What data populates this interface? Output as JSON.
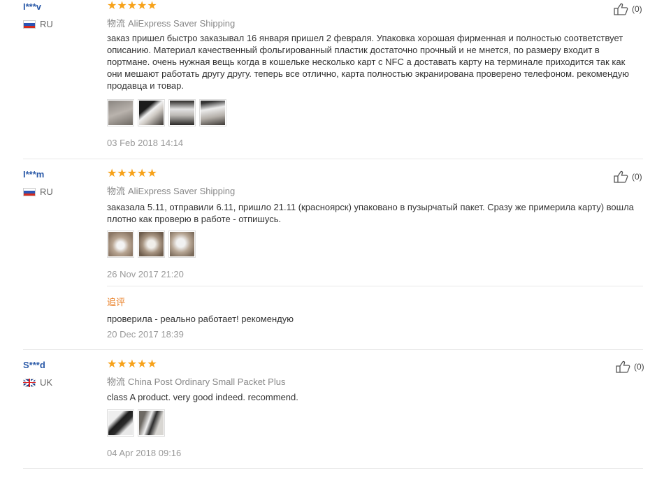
{
  "reviews": [
    {
      "user": "I***v",
      "country": "RU",
      "shipping_label": "物流",
      "shipping": "AliExpress Saver Shipping",
      "text": "заказ пришел быстро заказывал 16 января пришел 2 февраля. Упаковка хорошая фирменная и полностью соответствует описанию. Материал качественный фольгированный пластик достаточно прочный и не мнется, по размеру входит в портмане. очень нужная вещь когда в кошельке несколько карт с NFC а доставать карту на терминале приходится так как они мешают работать другу другу. теперь все отлично, карта полностью экранирована проверено телефоном. рекомендую продавца и товар.",
      "date": "03 Feb 2018 14:14",
      "helpful": "(0)",
      "rating": 5,
      "photo_count": 4
    },
    {
      "user": "I***m",
      "country": "RU",
      "shipping_label": "物流",
      "shipping": "AliExpress Saver Shipping",
      "text": "заказала 5.11, отправили 6.11, пришло 21.11 (красноярск) упаковано в пузырчатый пакет. Сразу же примерила карту) вошла плотно как проверю в работе - отпишусь.",
      "date": "26 Nov 2017 21:20",
      "helpful": "(0)",
      "rating": 5,
      "photo_count": 3,
      "followup": {
        "title": "追评",
        "text": "проверила - реально работает! рекомендую",
        "date": "20 Dec 2017 18:39"
      }
    },
    {
      "user": "S***d",
      "country": "UK",
      "shipping_label": "物流",
      "shipping": "China Post Ordinary Small Packet Plus",
      "text": "class A product. very good indeed. recommend.",
      "date": "04 Apr 2018 09:16",
      "helpful": "(0)",
      "rating": 5,
      "photo_count": 2
    }
  ],
  "stars_glyph": "★★★★★",
  "colors": {
    "star": "#f7a21a",
    "username": "#2b5aa8",
    "followup": "#e8791b"
  }
}
